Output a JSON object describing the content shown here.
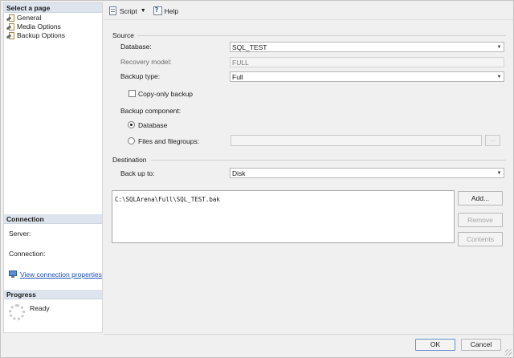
{
  "left_pane": {
    "select_page_header": "Select a page",
    "pages": [
      {
        "label": "General"
      },
      {
        "label": "Media Options"
      },
      {
        "label": "Backup Options"
      }
    ],
    "connection_header": "Connection",
    "server_label": "Server:",
    "connection_label": "Connection:",
    "view_connection_link": "View connection properties",
    "progress_header": "Progress",
    "progress_status": "Ready"
  },
  "toolbar": {
    "script_label": "Script",
    "help_label": "Help"
  },
  "source": {
    "group_label": "Source",
    "database_label": "Database:",
    "database_value": "SQL_TEST",
    "recovery_model_label": "Recovery model:",
    "recovery_model_value": "FULL",
    "backup_type_label": "Backup type:",
    "backup_type_value": "Full",
    "copy_only_label": "Copy-only backup",
    "copy_only_checked": false,
    "backup_component_label": "Backup component:",
    "component_database_label": "Database",
    "component_files_label": "Files and filegroups:",
    "selected_component": "Database",
    "ellipsis_label": "..."
  },
  "destination": {
    "group_label": "Destination",
    "back_up_to_label": "Back up to:",
    "back_up_to_value": "Disk",
    "paths": [
      "C:\\SQLArena\\Full\\SQL_TEST.bak"
    ],
    "add_button": "Add...",
    "remove_button": "Remove",
    "contents_button": "Contents"
  },
  "footer": {
    "ok_button": "OK",
    "cancel_button": "Cancel"
  }
}
